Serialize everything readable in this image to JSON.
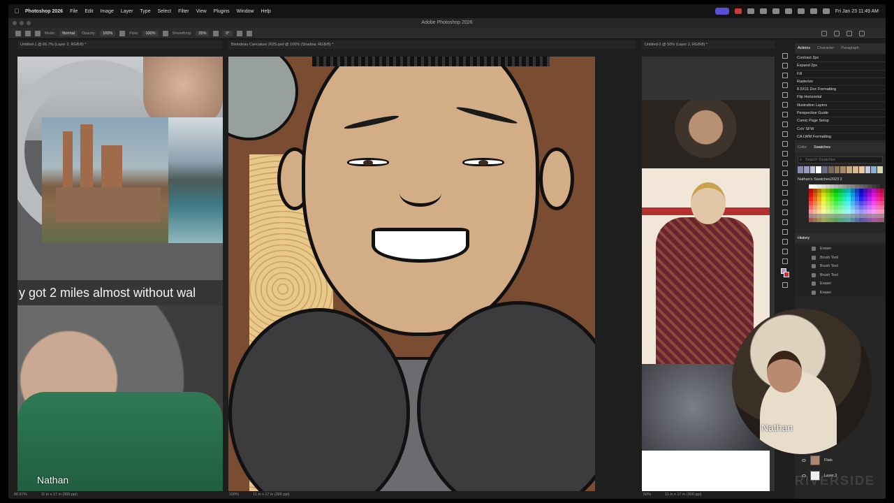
{
  "menubar": {
    "app_name": "Photoshop 2026",
    "items": [
      "File",
      "Edit",
      "Image",
      "Layer",
      "Type",
      "Select",
      "Filter",
      "View",
      "Plugins",
      "Window",
      "Help"
    ],
    "clock": "Fri Jan 23  11:49 AM"
  },
  "window": {
    "title": "Adobe Photoshop 2026"
  },
  "options": {
    "mode_label": "Mode:",
    "mode_value": "Normal",
    "opacity_label": "Opacity:",
    "opacity_value": "100%",
    "flow_label": "Flow:",
    "flow_value": "100%",
    "smoothing_label": "Smoothing:",
    "smoothing_value": "25%",
    "angle_value": "0°"
  },
  "docs": [
    {
      "tab": "Untitled-1 @ 66.7% (Layer 2, RGB/8) *",
      "zoom": "66.67%",
      "size": "11 in x 17 in (300 ppi)"
    },
    {
      "tab": "Bistodeau Caricature 2025.psd @ 100% (Shadow, RGB/8) *",
      "zoom": "100%",
      "size": "11 in x 17 in (300 ppi)"
    },
    {
      "tab": "Untitled-2 @ 50% (Layer 2, RGB/8) *",
      "zoom": "50%",
      "size": "11 in x 17 in (300 ppi)"
    }
  ],
  "left_doc": {
    "caption": "y got 2 miles almost without wal",
    "name_tag": "Nathan"
  },
  "panels": {
    "top_tabs": [
      "Actions",
      "Character",
      "Paragraph"
    ],
    "actions": [
      "Contract 2px",
      "Expand 2px",
      "Fill",
      "Rasterize",
      "8.5X11 Doc Formatting",
      "Flip Horizontal",
      "Illustration Layers",
      "Perspective Guide",
      "Comic Page Setup",
      "CoV SFW",
      "CA LWM Formatting"
    ],
    "swatch_tabs": [
      "Color",
      "Swatches"
    ],
    "search_placeholder": "Search Swatches",
    "swatch_group": "Nathan's Swatches2023 2",
    "history_title": "History",
    "history": [
      "Eraser",
      "Brush Tool",
      "Brush Tool",
      "Brush Tool",
      "Eraser",
      "Eraser"
    ],
    "layers": [
      "Flats",
      "Layer 3"
    ]
  },
  "webcam": {
    "name_tag": "Nathan"
  },
  "watermark": "RIVERSIDE",
  "colors": {
    "foreground": "#b58fc4",
    "background": "#d62d3a",
    "accent": "#5a4fd6"
  }
}
